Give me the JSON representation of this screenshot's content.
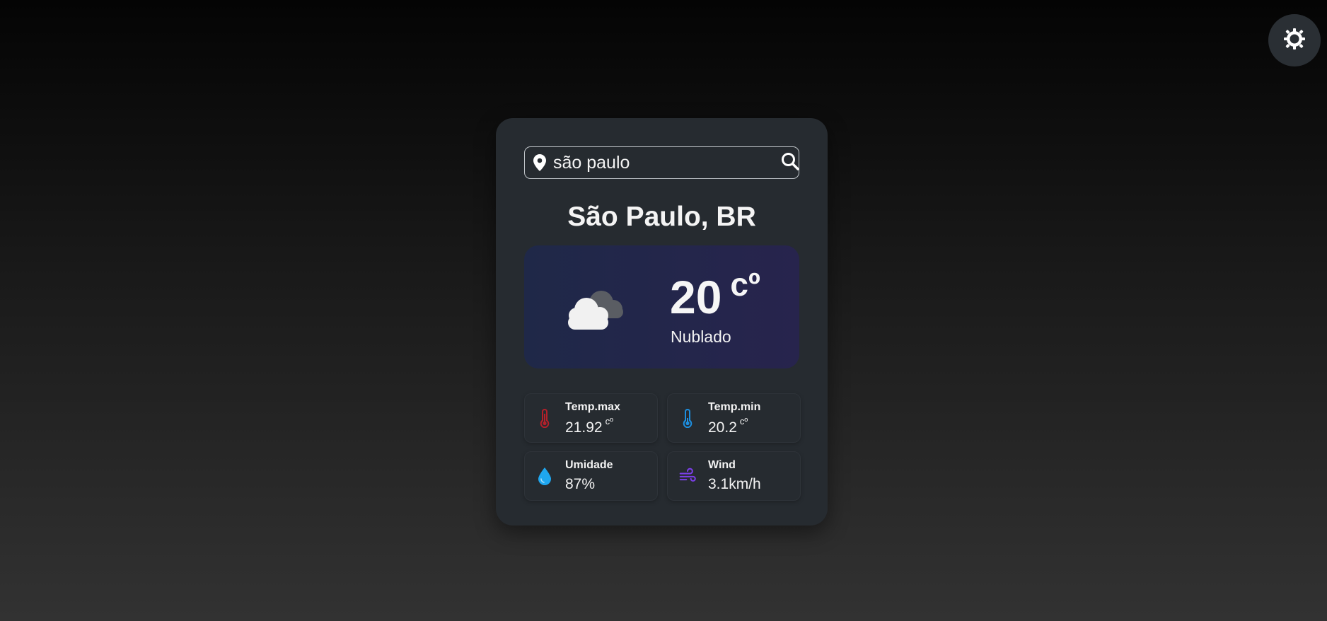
{
  "search": {
    "value": "são paulo",
    "placeholder": ""
  },
  "location": {
    "city": "São Paulo, BR"
  },
  "current": {
    "temperature": "20",
    "unit": "cº",
    "description": "Nublado",
    "icon": "cloudy-icon"
  },
  "stats": {
    "temp_max": {
      "label": "Temp.max",
      "value": "21.92",
      "unit": "cº",
      "icon": "thermometer-hot-icon",
      "color": "#b3202a"
    },
    "temp_min": {
      "label": "Temp.min",
      "value": "20.2",
      "unit": "cº",
      "icon": "thermometer-cold-icon",
      "color": "#1d8fe0"
    },
    "humidity": {
      "label": "Umidade",
      "value": "87%",
      "icon": "water-drop-icon",
      "color": "#1fa7f0"
    },
    "wind": {
      "label": "Wind",
      "value": "3.1km/h",
      "icon": "wind-icon",
      "color": "#7b3fe8"
    }
  },
  "theme_toggle": {
    "icon": "sun-icon"
  },
  "colors": {
    "card": "#262b30",
    "hero_start": "#1f2848",
    "hero_end": "#27244d"
  }
}
